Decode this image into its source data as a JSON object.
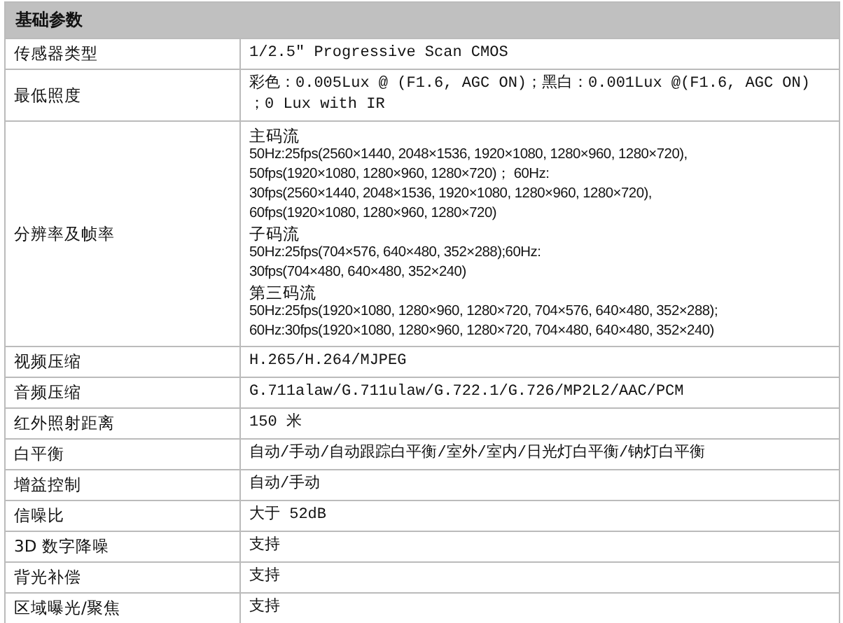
{
  "table": {
    "title": "基础参数",
    "rows": [
      {
        "label": "传感器类型",
        "value": "1/2.5\" Progressive Scan CMOS"
      },
      {
        "label": "最低照度",
        "value": "彩色：0.005Lux @ (F1.6, AGC ON)；黑白：0.001Lux @(F1.6, AGC ON) ；0 Lux with IR"
      },
      {
        "label": "分辨率及帧率",
        "lines": [
          {
            "kind": "heading",
            "text": "主码流"
          },
          {
            "kind": "detail",
            "text": "50Hz:25fps(2560×1440, 2048×1536, 1920×1080, 1280×960, 1280×720),"
          },
          {
            "kind": "detail",
            "text": "50fps(1920×1080, 1280×960, 1280×720)； 60Hz:"
          },
          {
            "kind": "detail",
            "text": "30fps(2560×1440, 2048×1536, 1920×1080, 1280×960, 1280×720),"
          },
          {
            "kind": "detail",
            "text": "60fps(1920×1080, 1280×960, 1280×720)"
          },
          {
            "kind": "heading",
            "text": "子码流"
          },
          {
            "kind": "detail",
            "text": "50Hz:25fps(704×576, 640×480, 352×288);60Hz:"
          },
          {
            "kind": "detail",
            "text": "30fps(704×480, 640×480, 352×240)"
          },
          {
            "kind": "heading",
            "text": "第三码流"
          },
          {
            "kind": "detail",
            "text": "50Hz:25fps(1920×1080, 1280×960, 1280×720, 704×576, 640×480, 352×288);"
          },
          {
            "kind": "detail",
            "text": "60Hz:30fps(1920×1080, 1280×960, 1280×720, 704×480, 640×480, 352×240)"
          }
        ]
      },
      {
        "label": "视频压缩",
        "value": "H.265/H.264/MJPEG"
      },
      {
        "label": "音频压缩",
        "value": "G.711alaw/G.711ulaw/G.722.1/G.726/MP2L2/AAC/PCM"
      },
      {
        "label": "红外照射距离",
        "value": "150 米"
      },
      {
        "label": "白平衡",
        "value": "自动/手动/自动跟踪白平衡/室外/室内/日光灯白平衡/钠灯白平衡"
      },
      {
        "label": "增益控制",
        "value": "自动/手动"
      },
      {
        "label": "信噪比",
        "value": "大于 52dB"
      },
      {
        "label": "3D 数字降噪",
        "value": "支持"
      },
      {
        "label": "背光补偿",
        "value": "支持"
      },
      {
        "label": "区域曝光/聚焦",
        "value": "支持"
      }
    ]
  }
}
